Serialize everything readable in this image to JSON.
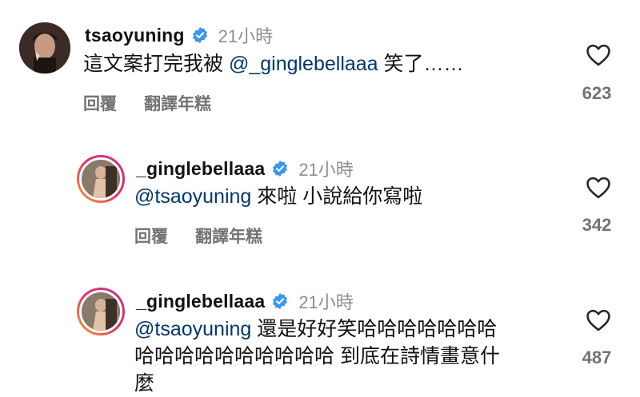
{
  "comments": [
    {
      "username": "tsaoyuning",
      "time": "21小時",
      "mention": "@_ginglebellaaa",
      "text_before": "這文案打完我被 ",
      "text_after": " 笑了……",
      "reply_label": "回覆",
      "translate_label": "翻譯年糕",
      "likes": "623"
    },
    {
      "username": "_ginglebellaaa",
      "time": "21小時",
      "mention": "@tsaoyuning",
      "text_after": " 來啦 小說給你寫啦",
      "reply_label": "回覆",
      "translate_label": "翻譯年糕",
      "likes": "342"
    },
    {
      "username": "_ginglebellaaa",
      "time": "21小時",
      "mention": "@tsaoyuning",
      "text_line1": " 還是好好笑哈哈哈哈哈哈哈",
      "text_line2": "哈哈哈哈哈哈哈哈哈哈 到底在詩情畫意什",
      "text_line3": "麼",
      "likes": "487"
    }
  ],
  "colors": {
    "mention": "#00376b",
    "verified": "#3897f0",
    "meta": "#8e8e8e"
  }
}
